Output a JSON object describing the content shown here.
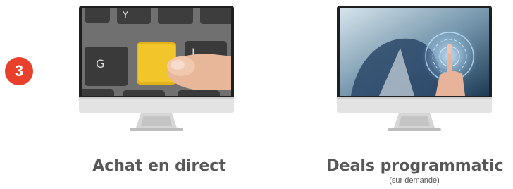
{
  "step": {
    "number": "3"
  },
  "cards": [
    {
      "title": "Achat en direct",
      "subtitle": "",
      "image": "keyboard-yellow-key-photo"
    },
    {
      "title": "Deals programmatic",
      "subtitle": "(sur demande)",
      "image": "businessman-touchscreen-photo"
    }
  ],
  "colors": {
    "badge": "#e8402a",
    "caption": "#575757",
    "monitor_bezel": "#1f1f1f",
    "monitor_chin": "#e6e6e6"
  }
}
